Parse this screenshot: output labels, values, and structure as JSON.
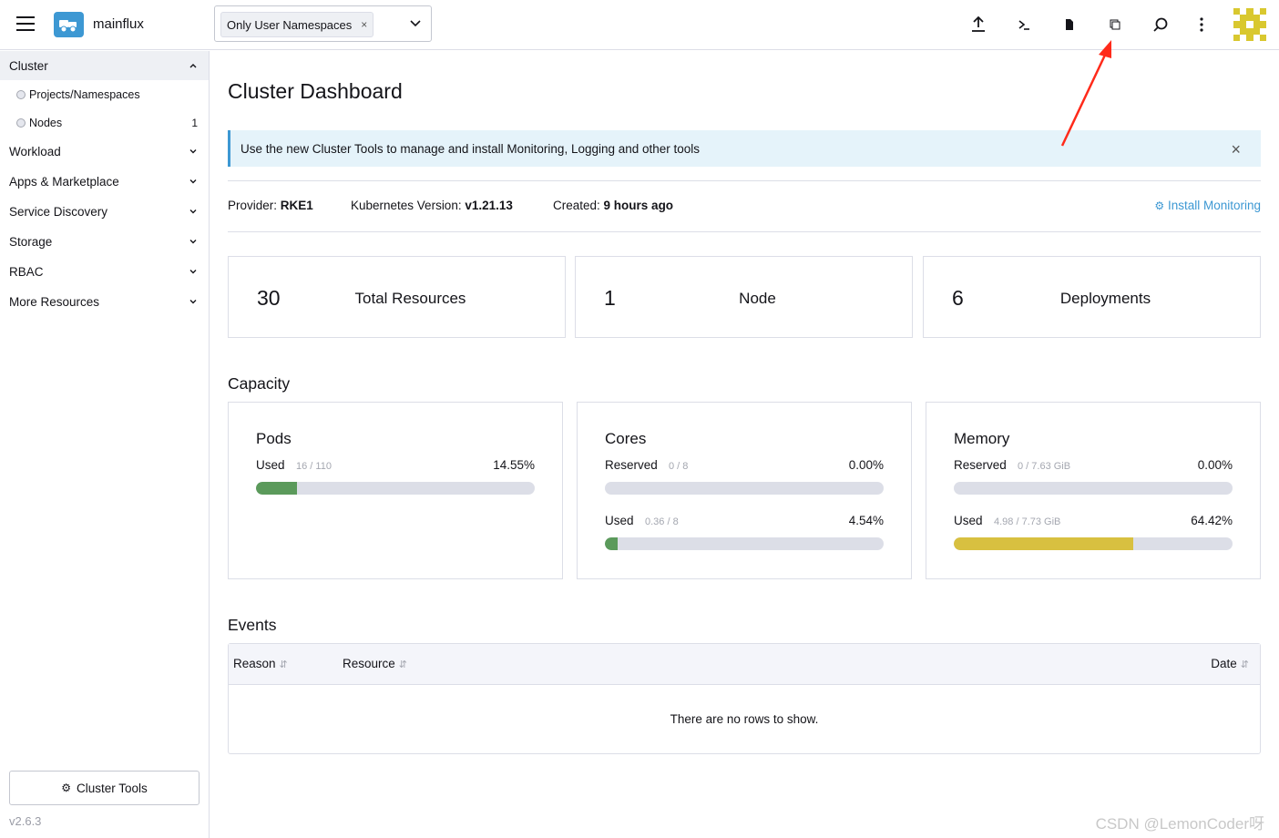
{
  "header": {
    "cluster_name": "mainflux",
    "namespace_filter": "Only User Namespaces",
    "namespace_remove": "×"
  },
  "sidebar": {
    "groups": [
      {
        "label": "Cluster",
        "expanded": true
      },
      {
        "label": "Workload"
      },
      {
        "label": "Apps & Marketplace"
      },
      {
        "label": "Service Discovery"
      },
      {
        "label": "Storage"
      },
      {
        "label": "RBAC"
      },
      {
        "label": "More Resources"
      }
    ],
    "cluster_items": [
      {
        "label": "Projects/Namespaces",
        "count": ""
      },
      {
        "label": "Nodes",
        "count": "1"
      }
    ],
    "cluster_tools_label": "Cluster Tools",
    "version": "v2.6.3"
  },
  "main": {
    "title": "Cluster Dashboard",
    "banner": "Use the new Cluster Tools to manage and install Monitoring, Logging and other tools",
    "banner_close": "×",
    "provider_label": "Provider:",
    "provider_value": "RKE1",
    "k8s_label": "Kubernetes Version:",
    "k8s_value": "v1.21.13",
    "created_label": "Created:",
    "created_value": "9 hours ago",
    "install_monitoring": "Install Monitoring",
    "stats": [
      {
        "value": "30",
        "label": "Total Resources"
      },
      {
        "value": "1",
        "label": "Node"
      },
      {
        "value": "6",
        "label": "Deployments"
      }
    ],
    "capacity_title": "Capacity",
    "capacity": {
      "pods": {
        "title": "Pods",
        "used_label": "Used",
        "used_frac": "16 / 110",
        "used_pct": "14.55%",
        "used_fill": 0.1455
      },
      "cores": {
        "title": "Cores",
        "reserved_label": "Reserved",
        "reserved_frac": "0 / 8",
        "reserved_pct": "0.00%",
        "reserved_fill": 0,
        "used_label": "Used",
        "used_frac": "0.36 / 8",
        "used_pct": "4.54%",
        "used_fill": 0.0454
      },
      "memory": {
        "title": "Memory",
        "reserved_label": "Reserved",
        "reserved_frac": "0 / 7.63 GiB",
        "reserved_pct": "0.00%",
        "reserved_fill": 0,
        "used_label": "Used",
        "used_frac": "4.98 / 7.73 GiB",
        "used_pct": "64.42%",
        "used_fill": 0.6442
      }
    },
    "events_title": "Events",
    "events_columns": [
      "Reason",
      "Resource",
      "Date"
    ],
    "events_empty": "There are no rows to show."
  },
  "colors": {
    "accent": "#3d98d3",
    "fill_green": "#5b9a5b",
    "fill_yellow": "#d8c040",
    "annotation_arrow": "#ff2a1a"
  },
  "icons": [
    "upload-icon",
    "terminal-icon",
    "file-icon",
    "copy-icon",
    "search-icon",
    "more-icon",
    "gear-icon"
  ],
  "watermark": "CSDN @LemonCoder呀"
}
